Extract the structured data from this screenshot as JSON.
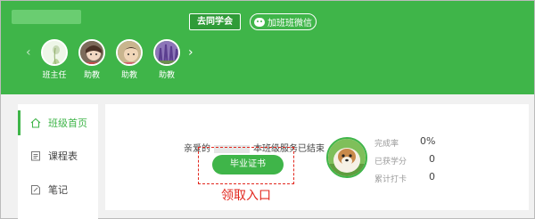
{
  "header": {
    "alumni_button": "去同学会",
    "wechat_button": "加班班微信",
    "staff": [
      {
        "role": "班主任",
        "avatar": "teacher-avatar"
      },
      {
        "role": "助教",
        "avatar": "assistant-avatar"
      },
      {
        "role": "助教",
        "avatar": "assistant-avatar"
      },
      {
        "role": "助教",
        "avatar": "assistant-avatar"
      }
    ]
  },
  "sidebar": {
    "items": [
      {
        "label": "班级首页",
        "icon": "home-icon"
      },
      {
        "label": "课程表",
        "icon": "schedule-icon"
      },
      {
        "label": "笔记",
        "icon": "note-icon"
      }
    ]
  },
  "main": {
    "greeting_prefix": "亲爱的",
    "greeting_suffix": "本班级服务已结束",
    "certificate_button": "毕业证书",
    "annotation": "领取入口",
    "stats": [
      {
        "label": "完成率",
        "value": "0%"
      },
      {
        "label": "已获学分",
        "value": "0"
      },
      {
        "label": "累计打卡",
        "value": "0"
      }
    ]
  },
  "colors": {
    "brand_green": "#3fb549",
    "annotation_red": "#e2261d"
  }
}
